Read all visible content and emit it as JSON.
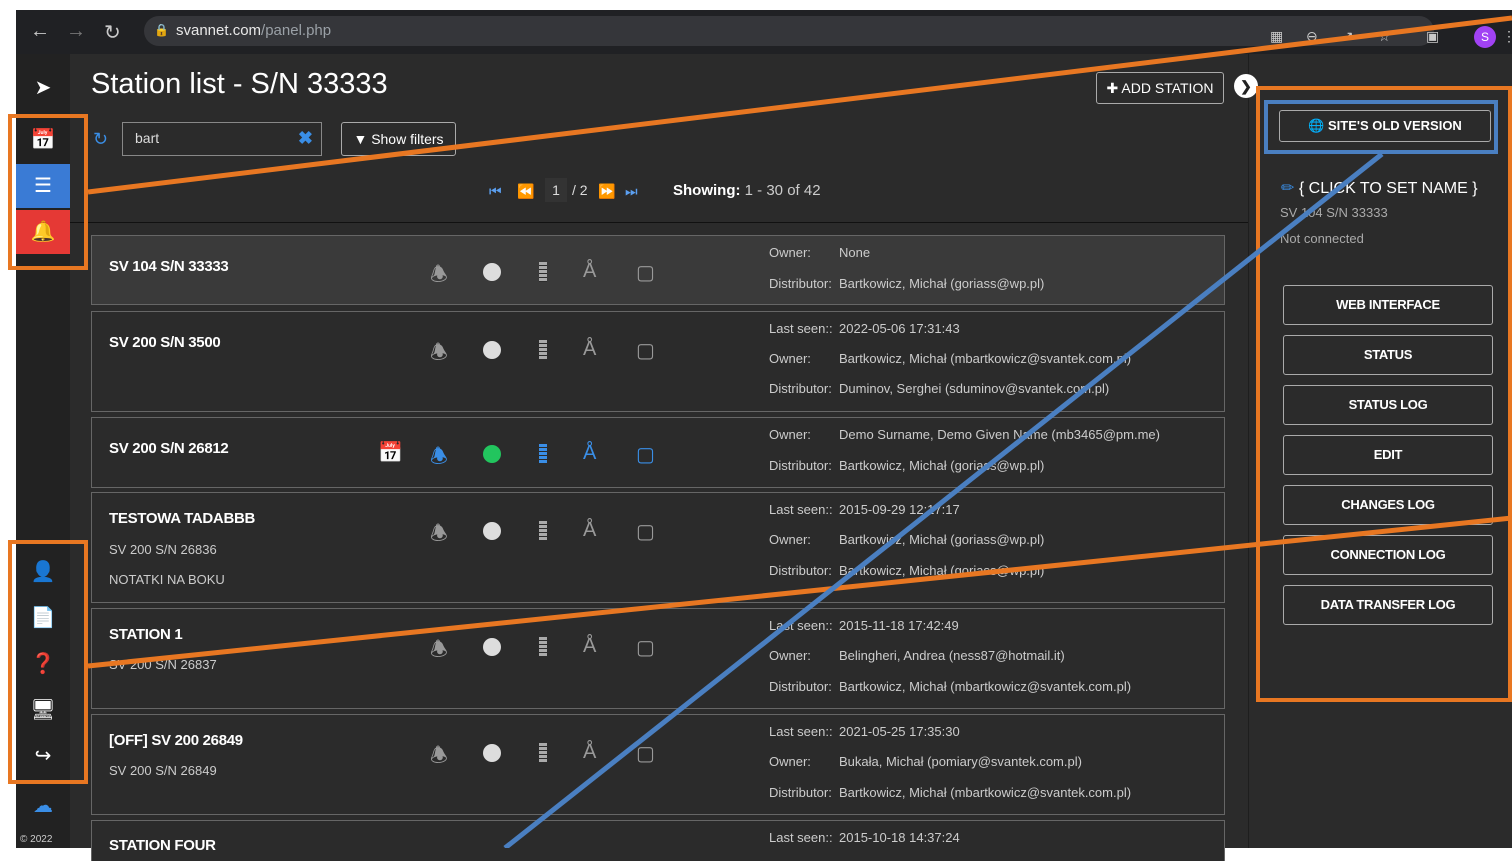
{
  "browser": {
    "host": "svannet.com",
    "path": "/panel.php",
    "profile_initial": "S"
  },
  "page": {
    "title": "Station list - S/N 33333",
    "add_station": "ADD STATION",
    "search_value": "bart",
    "show_filters": "Show filters",
    "pager": {
      "current": "1",
      "total": "/ 2"
    },
    "showing_label": "Showing:",
    "showing_value": "1 - 30 of 42"
  },
  "labels": {
    "owner": "Owner:",
    "distributor": "Distributor:",
    "last_seen": "Last seen::"
  },
  "stations": [
    {
      "name": "SV 104 S/N 33333",
      "sub1": "",
      "sub2": "",
      "last_seen": "",
      "owner": "None",
      "distributor": "Bartkowicz, Michał (goriass@wp.pl)"
    },
    {
      "name": "SV 200 S/N 3500",
      "sub1": "",
      "sub2": "",
      "last_seen": "2022-05-06 17:31:43",
      "owner": "Bartkowicz, Michał (mbartkowicz@svantek.com.pl)",
      "distributor": "Duminov, Serghei (sduminov@svantek.com.pl)"
    },
    {
      "name": "SV 200 S/N 26812",
      "sub1": "",
      "sub2": "",
      "last_seen": "",
      "owner": "Demo Surname, Demo Given Name (mb3465@pm.me)",
      "distributor": "Bartkowicz, Michał (goriass@wp.pl)"
    },
    {
      "name": "TESTOWA TADABBB",
      "sub1": "SV 200 S/N 26836",
      "sub2": "NOTATKI NA BOKU",
      "last_seen": "2015-09-29 12:17:17",
      "owner": "Bartkowicz, Michał (goriass@wp.pl)",
      "distributor": "Bartkowicz, Michał (goriass@wp.pl)"
    },
    {
      "name": "STATION 1",
      "sub1": "SV 200 S/N 26837",
      "sub2": "",
      "last_seen": "2015-11-18 17:42:49",
      "owner": "Belingheri, Andrea (ness87@hotmail.it)",
      "distributor": "Bartkowicz, Michał (mbartkowicz@svantek.com.pl)"
    },
    {
      "name": "[OFF] SV 200 26849",
      "sub1": "SV 200 S/N 26849",
      "sub2": "",
      "last_seen": "2021-05-25 17:35:30",
      "owner": "Bukała, Michał (pomiary@svantek.com.pl)",
      "distributor": "Bartkowicz, Michał (mbartkowicz@svantek.com.pl)"
    },
    {
      "name": "STATION FOUR",
      "sub1": "",
      "sub2": "",
      "last_seen": "2015-10-18 14:37:24",
      "owner": "",
      "distributor": ""
    }
  ],
  "right_panel": {
    "old_version": "SITE'S OLD VERSION",
    "set_name": "{ CLICK TO SET NAME }",
    "serial": "SV 104 S/N 33333",
    "connection": "Not connected",
    "buttons": [
      "WEB INTERFACE",
      "STATUS",
      "STATUS LOG",
      "EDIT",
      "CHANGES LOG",
      "CONNECTION LOG",
      "DATA TRANSFER LOG"
    ]
  },
  "footer": {
    "copyright": "© 2022"
  },
  "colors": {
    "annotation_orange": "#e87722",
    "annotation_blue": "#4a7fc1",
    "accent": "#3a8ee6",
    "alert": "#e53935"
  }
}
